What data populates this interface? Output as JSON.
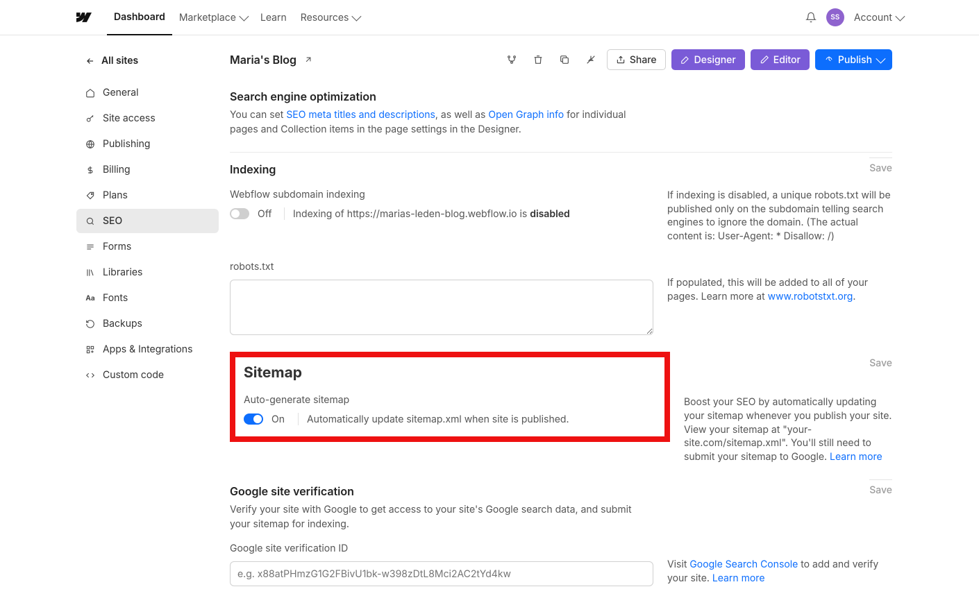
{
  "topnav": {
    "items": [
      "Dashboard",
      "Marketplace",
      "Learn",
      "Resources"
    ],
    "avatar_initials": "SS",
    "account_label": "Account"
  },
  "sidebar": {
    "back_label": "All sites",
    "items": [
      {
        "label": "General"
      },
      {
        "label": "Site access"
      },
      {
        "label": "Publishing"
      },
      {
        "label": "Billing"
      },
      {
        "label": "Plans"
      },
      {
        "label": "SEO"
      },
      {
        "label": "Forms"
      },
      {
        "label": "Libraries"
      },
      {
        "label": "Fonts"
      },
      {
        "label": "Backups"
      },
      {
        "label": "Apps & Integrations"
      },
      {
        "label": "Custom code"
      }
    ]
  },
  "titlebar": {
    "site_name": "Maria's Blog",
    "buttons": {
      "share": "Share",
      "designer": "Designer",
      "editor": "Editor",
      "publish": "Publish"
    }
  },
  "seo_intro": {
    "heading": "Search engine optimization",
    "text_prefix": "You can set ",
    "link1": "SEO meta titles and descriptions",
    "text_mid": ", as well as ",
    "link2": "Open Graph info",
    "text_suffix": " for individual pages and Collection items in the page settings in the Designer."
  },
  "indexing": {
    "heading": "Indexing",
    "save": "Save",
    "field_label": "Webflow subdomain indexing",
    "toggle_state": "Off",
    "desc_prefix": "Indexing of https://marias-leden-blog.webflow.io is ",
    "desc_emph": "disabled",
    "help": "If indexing is disabled, a unique robots.txt will be published only on the subdomain telling search engines to ignore the domain. (The actual content is: User-Agent: * Disallow: /)",
    "robots_label": "robots.txt",
    "robots_value": "",
    "robots_help_prefix": "If populated, this will be added to all of your pages. Learn more at ",
    "robots_help_link": "www.robotstxt.org",
    "robots_help_suffix": "."
  },
  "sitemap": {
    "heading": "Sitemap",
    "save": "Save",
    "field_label": "Auto-generate sitemap",
    "toggle_state": "On",
    "desc": "Automatically update sitemap.xml when site is published.",
    "help_prefix": "Boost your SEO by automatically updating your sitemap whenever you publish your site. View your sitemap at \"your-site.com/sitemap.xml\". You'll still need to submit your sitemap to Google. ",
    "help_link": "Learn more"
  },
  "gsv": {
    "heading": "Google site verification",
    "save": "Save",
    "sub": "Verify your site with Google to get access to your site's Google search data, and submit your sitemap for indexing.",
    "field_label": "Google site verification ID",
    "placeholder": "e.g. x88atPHmzG1G2FBivU1bk-w398zDtL8Mci2AC2tYd4kw",
    "help_prefix": "Visit ",
    "help_link": "Google Search Console",
    "help_mid": " to add and verify your site. ",
    "help_link2": "Learn more"
  }
}
